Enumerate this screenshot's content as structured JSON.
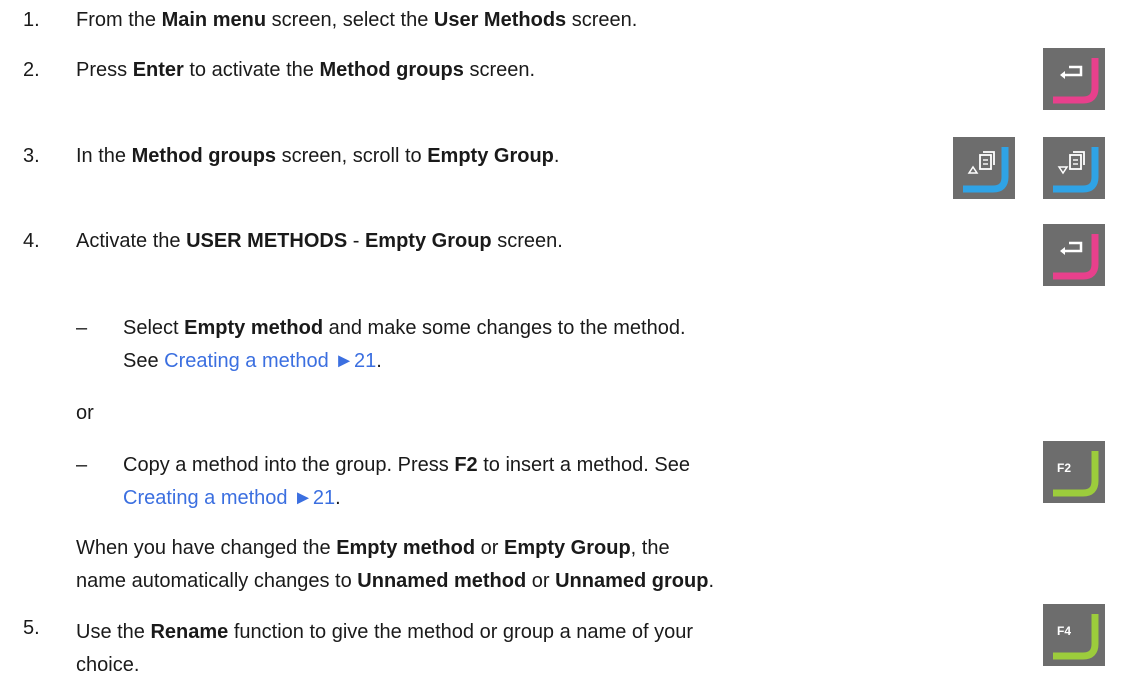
{
  "steps": [
    {
      "number": "1.",
      "parts": [
        "From the ",
        "Main menu",
        " screen, select the ",
        "User Methods",
        " screen."
      ]
    },
    {
      "number": "2.",
      "parts": [
        "Press ",
        "Enter",
        " to activate the ",
        "Method groups",
        " screen."
      ]
    },
    {
      "number": "3.",
      "parts": [
        "In the ",
        "Method groups",
        " screen, scroll to ",
        "Empty Group",
        "."
      ]
    },
    {
      "number": "4.",
      "parts": [
        "Activate the ",
        "USER METHODS",
        " - ",
        "Empty Group",
        " screen."
      ]
    },
    {
      "number": "5.",
      "lines": [
        [
          "Use the ",
          "Rename",
          " function to give the method or group a name of your"
        ],
        [
          "choice."
        ]
      ]
    }
  ],
  "substep_a": {
    "dash": "–",
    "line1": [
      "Select ",
      "Empty method",
      " and make some changes to the method."
    ],
    "line2_prefix": "See ",
    "link": "Creating a method ►21",
    "line2_suffix": "."
  },
  "or_text": "or",
  "substep_b": {
    "dash": "–",
    "line1": [
      "Copy a method into the group. Press ",
      "F2",
      " to insert a method. See"
    ],
    "link": "Creating a method ►21",
    "line2_suffix": "."
  },
  "note": {
    "line1": [
      "When you have changed the ",
      "Empty method",
      " or ",
      "Empty Group",
      ", the"
    ],
    "line2": [
      "name automatically changes to ",
      "Unnamed method",
      " or ",
      "Unnamed group",
      "."
    ]
  },
  "keys": {
    "enter_1": {
      "icon": "enter-icon",
      "accent": "#e8408c"
    },
    "scroll_up": {
      "icon": "scroll-up-icon",
      "accent": "#2fa3e6"
    },
    "scroll_down": {
      "icon": "scroll-down-icon",
      "accent": "#2fa3e6"
    },
    "enter_2": {
      "icon": "enter-icon",
      "accent": "#e8408c"
    },
    "f2": {
      "label": "F2",
      "accent": "#9ccc3c"
    },
    "f4": {
      "label": "F4",
      "accent": "#9ccc3c"
    }
  }
}
